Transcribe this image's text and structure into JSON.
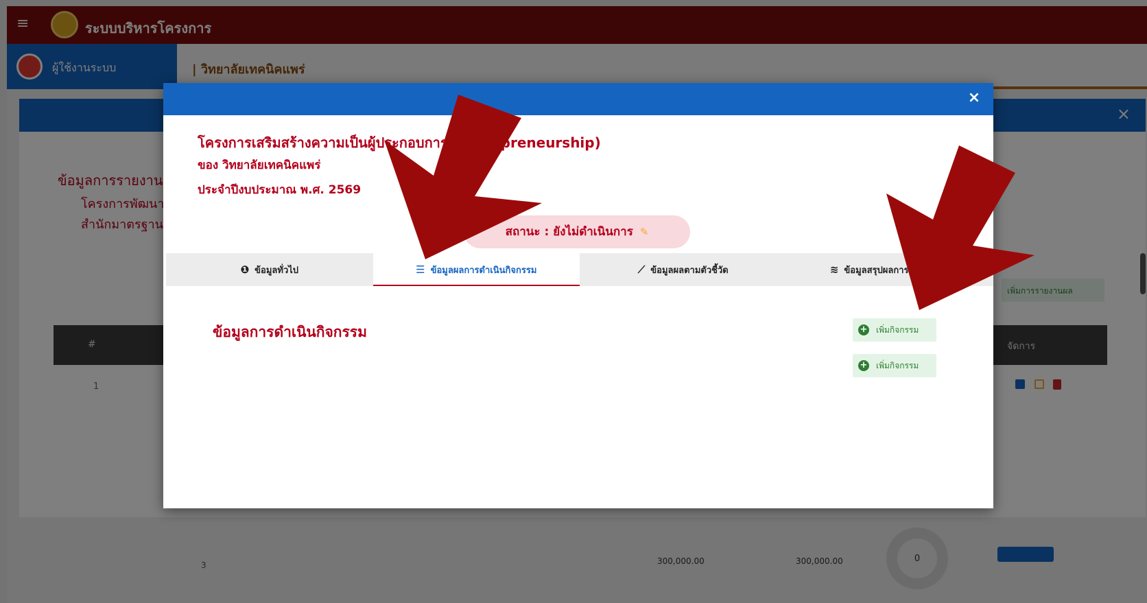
{
  "app": {
    "brand": "ระบบบริหารโครงการ",
    "user_name": "ผู้ใช้งานระบบ",
    "breadcrumb": "| วิทยาลัยเทคนิคแพร่"
  },
  "background_modal": {
    "title": "ข้อมูลการรายงานผล",
    "line1": "โครงการพัฒนา",
    "line2": "สำนักมาตรฐาน",
    "table_hash": "#",
    "table_actions": "จัดการ",
    "row_number": "1",
    "add_report_label": "เพิ่มการรายงานผล"
  },
  "bottom_row": {
    "number": "3",
    "amount1": "300,000.00",
    "amount2": "300,000.00",
    "donut_value": "0"
  },
  "modal": {
    "close_label": "×",
    "project_title": "โครงการเสริมสร้างความเป็นผู้ประกอบการ (Entrepreneurship)",
    "owner": "ของ วิทยาลัยเทคนิคแพร่",
    "fiscal_year": "ประจำปีงบประมาณ พ.ศ. 2569",
    "status": "สถานะ : ยังไม่ดำเนินการ",
    "tabs": [
      {
        "label": "ข้อมูลทั่วไป",
        "icon": "info-icon"
      },
      {
        "label": "ข้อมูลผลการดำเนินกิจกรรม",
        "icon": "list-icon"
      },
      {
        "label": "ข้อมูลผลตามตัวชี้วัด",
        "icon": "chart-line-icon"
      },
      {
        "label": "ข้อมูลสรุปผลการดำเนินการ",
        "icon": "coins-icon"
      }
    ],
    "active_tab": 1,
    "section_title": "ข้อมูลการดำเนินกิจกรรม",
    "add_activity_label": "เพิ่มกิจกรรม"
  },
  "colors": {
    "header_blue": "#1565c0",
    "title_red": "#b3001b",
    "arrow_red": "#9b0a0a",
    "add_green": "#2e7d32"
  }
}
